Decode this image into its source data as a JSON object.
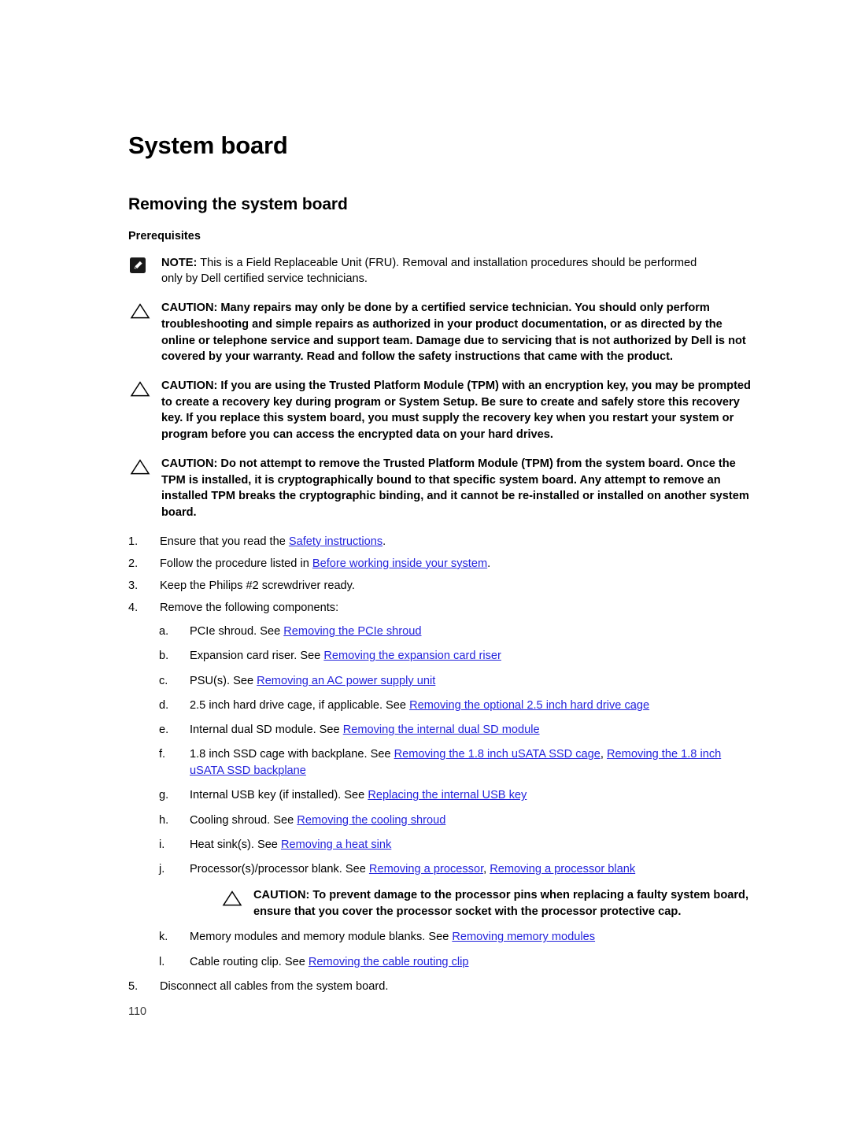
{
  "document": {
    "title": "System board",
    "section_title": "Removing the system board",
    "subsection_title": "Prerequisites",
    "page_number": "110"
  },
  "icons": {
    "note": "note-pencil-icon",
    "caution": "caution-triangle-icon"
  },
  "colors": {
    "link": "#2323dc",
    "text": "#000000",
    "background": "#ffffff",
    "page_number": "#3a3a3a"
  },
  "admonitions": [
    {
      "kind": "NOTE",
      "label": "NOTE:",
      "text": " This is a Field Replaceable Unit (FRU). Removal and installation procedures should be performed only by Dell certified service technicians."
    },
    {
      "kind": "CAUTION",
      "label": "CAUTION:",
      "text": " Many repairs may only be done by a certified service technician. You should only perform troubleshooting and simple repairs as authorized in your product documentation, or as directed by the online or telephone service and support team. Damage due to servicing that is not authorized by Dell is not covered by your warranty. Read and follow the safety instructions that came with the product."
    },
    {
      "kind": "CAUTION",
      "label": "CAUTION:",
      "text": " If you are using the Trusted Platform Module (TPM) with an encryption key, you may be prompted to create a recovery key during program or System Setup. Be sure to create and safely store this recovery key. If you replace this system board, you must supply the recovery key when you restart your system or program before you can access the encrypted data on your hard drives."
    },
    {
      "kind": "CAUTION",
      "label": "CAUTION:",
      "text": " Do not attempt to remove the Trusted Platform Module (TPM) from the system board. Once the TPM is installed, it is cryptographically bound to that specific system board. Any attempt to remove an installed TPM breaks the cryptographic binding, and it cannot be re-installed or installed on another system board."
    }
  ],
  "nested_caution": {
    "kind": "CAUTION",
    "label": "CAUTION:",
    "text": " To prevent damage to the processor pins when replacing a faulty system board, ensure that you cover the processor socket with the processor protective cap."
  },
  "steps": [
    {
      "marker": "1.",
      "before": "Ensure that you read the ",
      "link": "Safety instructions",
      "after": "."
    },
    {
      "marker": "2.",
      "before": "Follow the procedure listed in ",
      "link": "Before working inside your system",
      "after": "."
    },
    {
      "marker": "3.",
      "before": "Keep the Philips #2 screwdriver ready.",
      "link": "",
      "after": ""
    },
    {
      "marker": "4.",
      "before": "Remove the following components:",
      "link": "",
      "after": ""
    },
    {
      "marker": "5.",
      "before": "Disconnect all cables from the system board.",
      "link": "",
      "after": ""
    }
  ],
  "substeps": [
    {
      "marker": "a.",
      "before": "PCIe shroud. See ",
      "link1": "Removing the PCIe shroud",
      "mid": "",
      "link2": "",
      "after": ""
    },
    {
      "marker": "b.",
      "before": "Expansion card riser. See ",
      "link1": "Removing the expansion card riser",
      "mid": "",
      "link2": "",
      "after": ""
    },
    {
      "marker": "c.",
      "before": "PSU(s). See ",
      "link1": "Removing an AC power supply unit",
      "mid": "",
      "link2": "",
      "after": ""
    },
    {
      "marker": "d.",
      "before": "2.5 inch hard drive cage, if applicable. See ",
      "link1": "Removing the optional 2.5 inch hard drive cage",
      "mid": "",
      "link2": "",
      "after": ""
    },
    {
      "marker": "e.",
      "before": "Internal dual SD module. See ",
      "link1": "Removing the internal dual SD module",
      "mid": "",
      "link2": "",
      "after": ""
    },
    {
      "marker": "f.",
      "before": "1.8 inch SSD cage with backplane. See ",
      "link1": "Removing the 1.8 inch uSATA SSD cage",
      "mid": ", ",
      "link2": "Removing the 1.8 inch uSATA SSD backplane",
      "after": ""
    },
    {
      "marker": "g.",
      "before": "Internal USB key (if installed). See ",
      "link1": "Replacing the internal USB key",
      "mid": "",
      "link2": "",
      "after": ""
    },
    {
      "marker": "h.",
      "before": "Cooling shroud. See ",
      "link1": "Removing the cooling shroud",
      "mid": "",
      "link2": "",
      "after": ""
    },
    {
      "marker": "i.",
      "before": "Heat sink(s). See ",
      "link1": "Removing a heat sink",
      "mid": "",
      "link2": "",
      "after": ""
    },
    {
      "marker": "j.",
      "before": "Processor(s)/processor blank. See ",
      "link1": "Removing a processor",
      "mid": ", ",
      "link2": "Removing a processor blank",
      "after": ""
    },
    {
      "marker": "k.",
      "before": "Memory modules and memory module blanks. See ",
      "link1": "Removing memory modules",
      "mid": "",
      "link2": "",
      "after": ""
    },
    {
      "marker": "l.",
      "before": "Cable routing clip. See ",
      "link1": "Removing the cable routing clip",
      "mid": "",
      "link2": "",
      "after": ""
    }
  ]
}
